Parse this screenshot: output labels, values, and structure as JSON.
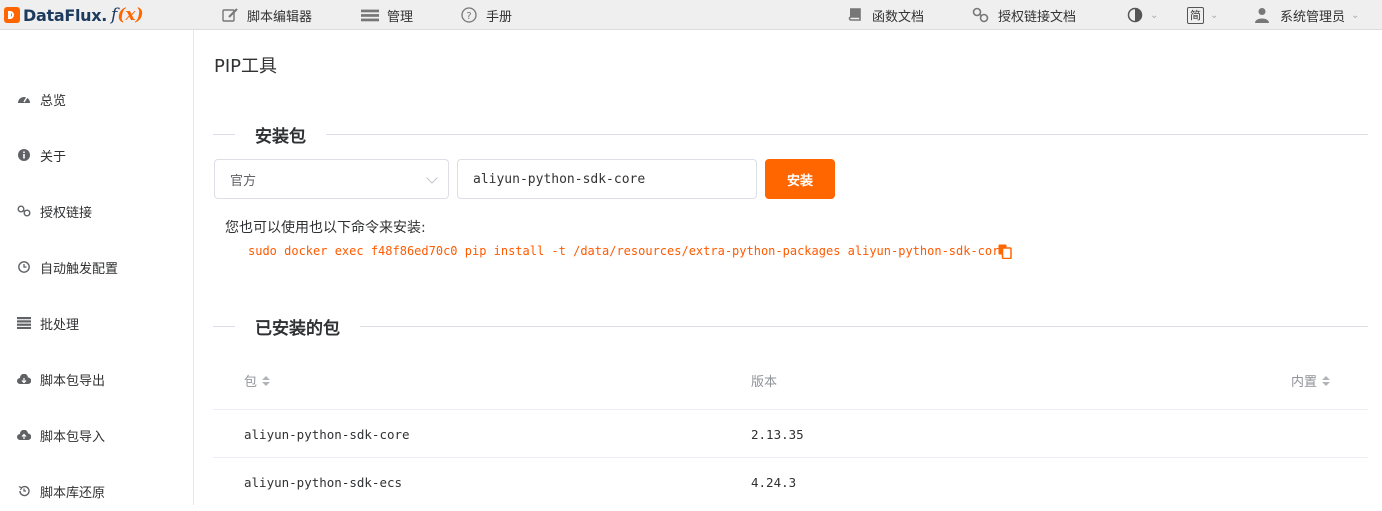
{
  "app": {
    "logo_text": "DataFlux.",
    "logo_fx_prefix": "f",
    "logo_fx_var": "(x)"
  },
  "topnav": {
    "script_editor": "脚本编辑器",
    "management": "管理",
    "manual": "手册",
    "func_docs": "函数文档",
    "auth_link_docs": "授权链接文档",
    "lang": "简",
    "user": "系统管理员"
  },
  "sidebar": {
    "items": [
      {
        "label": "总览",
        "icon": "dashboard-icon"
      },
      {
        "label": "关于",
        "icon": "info-icon"
      },
      {
        "label": "授权链接",
        "icon": "link-icon"
      },
      {
        "label": "自动触发配置",
        "icon": "clock-icon"
      },
      {
        "label": "批处理",
        "icon": "tasks-icon"
      },
      {
        "label": "脚本包导出",
        "icon": "cloud-download-icon"
      },
      {
        "label": "脚本包导入",
        "icon": "cloud-upload-icon"
      },
      {
        "label": "脚本库还原",
        "icon": "history-icon"
      }
    ]
  },
  "page": {
    "title": "PIP工具",
    "install_section": "安装包",
    "source_select": "官方",
    "package_input": "aliyun-python-sdk-core",
    "install_button": "安装",
    "hint": "您也可以使用也以下命令来安装:",
    "command": "sudo docker exec f48f86ed70c0 pip install -t /data/resources/extra-python-packages aliyun-python-sdk-core",
    "installed_section": "已安装的包"
  },
  "table": {
    "headers": {
      "package": "包",
      "version": "版本",
      "builtin": "内置"
    },
    "rows": [
      {
        "package": "aliyun-python-sdk-core",
        "version": "2.13.35"
      },
      {
        "package": "aliyun-python-sdk-ecs",
        "version": "4.24.3"
      }
    ]
  },
  "colors": {
    "accent": "#ff6600",
    "command": "#ff5a00"
  }
}
